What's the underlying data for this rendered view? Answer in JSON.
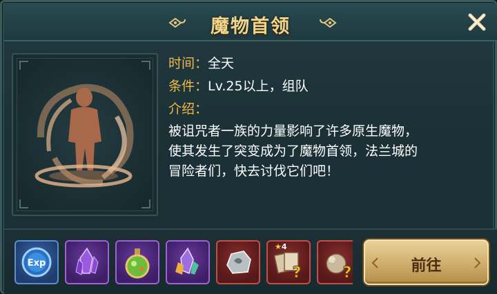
{
  "dialog": {
    "title": "魔物首领",
    "close_icon": "close-icon"
  },
  "info": {
    "time_label": "时间：",
    "time_value": "全天",
    "condition_label": "条件：",
    "condition_value": "Lv.25以上，组队",
    "intro_label": "介绍：",
    "description_lines": [
      "被诅咒者一族的力量影响了许多原生魔物，",
      "使其发生了突变成为了魔物首领，法兰城的",
      "冒险者们，快去讨伐它们吧！"
    ]
  },
  "portrait": {
    "icon": "cursed-boss-silhouette-icon"
  },
  "rewards": [
    {
      "icon": "exp-icon",
      "rarity": "blue",
      "label": "Exp"
    },
    {
      "icon": "purple-crystal-icon",
      "rarity": "purple"
    },
    {
      "icon": "green-potion-icon",
      "rarity": "purple"
    },
    {
      "icon": "rainbow-crystal-icon",
      "rarity": "purple"
    },
    {
      "icon": "silver-ore-icon",
      "rarity": "red"
    },
    {
      "icon": "mystery-card-pack-icon",
      "rarity": "red",
      "star_count": "4"
    },
    {
      "icon": "mystery-bag-icon",
      "rarity": "red"
    }
  ],
  "actions": {
    "go_label": "前往"
  },
  "colors": {
    "title": "#f0d58c",
    "label": "#f0b94a",
    "text": "#ffffff",
    "button": "#d2b070"
  }
}
